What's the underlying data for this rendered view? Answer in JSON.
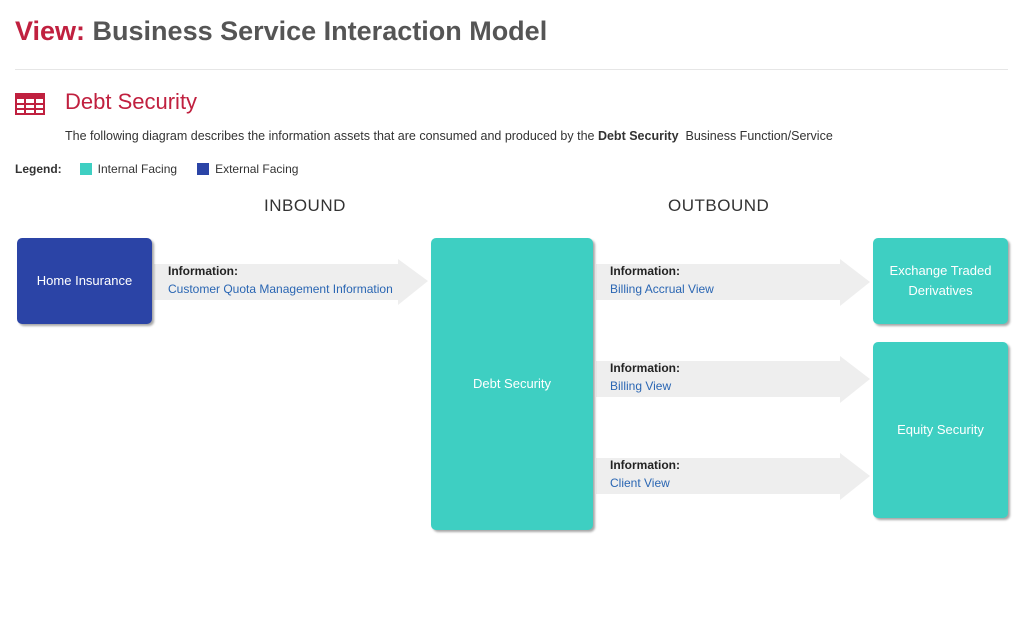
{
  "header": {
    "view_prefix": "View:",
    "view_name": "Business Service Interaction Model"
  },
  "function": {
    "icon": "table-grid-icon",
    "name": "Debt Security",
    "description_pre": "The following diagram describes the information assets that are consumed and produced by the ",
    "description_bold": "Debt Security",
    "description_post": "  Business Function/Service"
  },
  "legend": {
    "label": "Legend:",
    "items": [
      {
        "label": "Internal Facing",
        "color": "#3ecfc2"
      },
      {
        "label": "External Facing",
        "color": "#2b44a6"
      }
    ]
  },
  "sections": {
    "inbound": "INBOUND",
    "outbound": "OUTBOUND"
  },
  "colors": {
    "internal": "#3ecfc2",
    "external": "#2b44a6",
    "arrow": "#eeeeee",
    "accent": "#c0203f",
    "link": "#2a66b3"
  },
  "diagram": {
    "inbound_sources": [
      {
        "name": "Home Insurance",
        "facing": "external"
      }
    ],
    "center": {
      "name": "Debt Security",
      "facing": "internal"
    },
    "inbound_flows": [
      {
        "heading": "Information:",
        "asset": "Customer Quota Management Information"
      }
    ],
    "outbound_flows": [
      {
        "heading": "Information:",
        "asset": "Billing Accrual View"
      },
      {
        "heading": "Information:",
        "asset": "Billing View"
      },
      {
        "heading": "Information:",
        "asset": "Client View"
      }
    ],
    "outbound_targets": [
      {
        "name": "Exchange Traded Derivatives",
        "facing": "internal"
      },
      {
        "name": "Equity Security",
        "facing": "internal"
      }
    ]
  }
}
